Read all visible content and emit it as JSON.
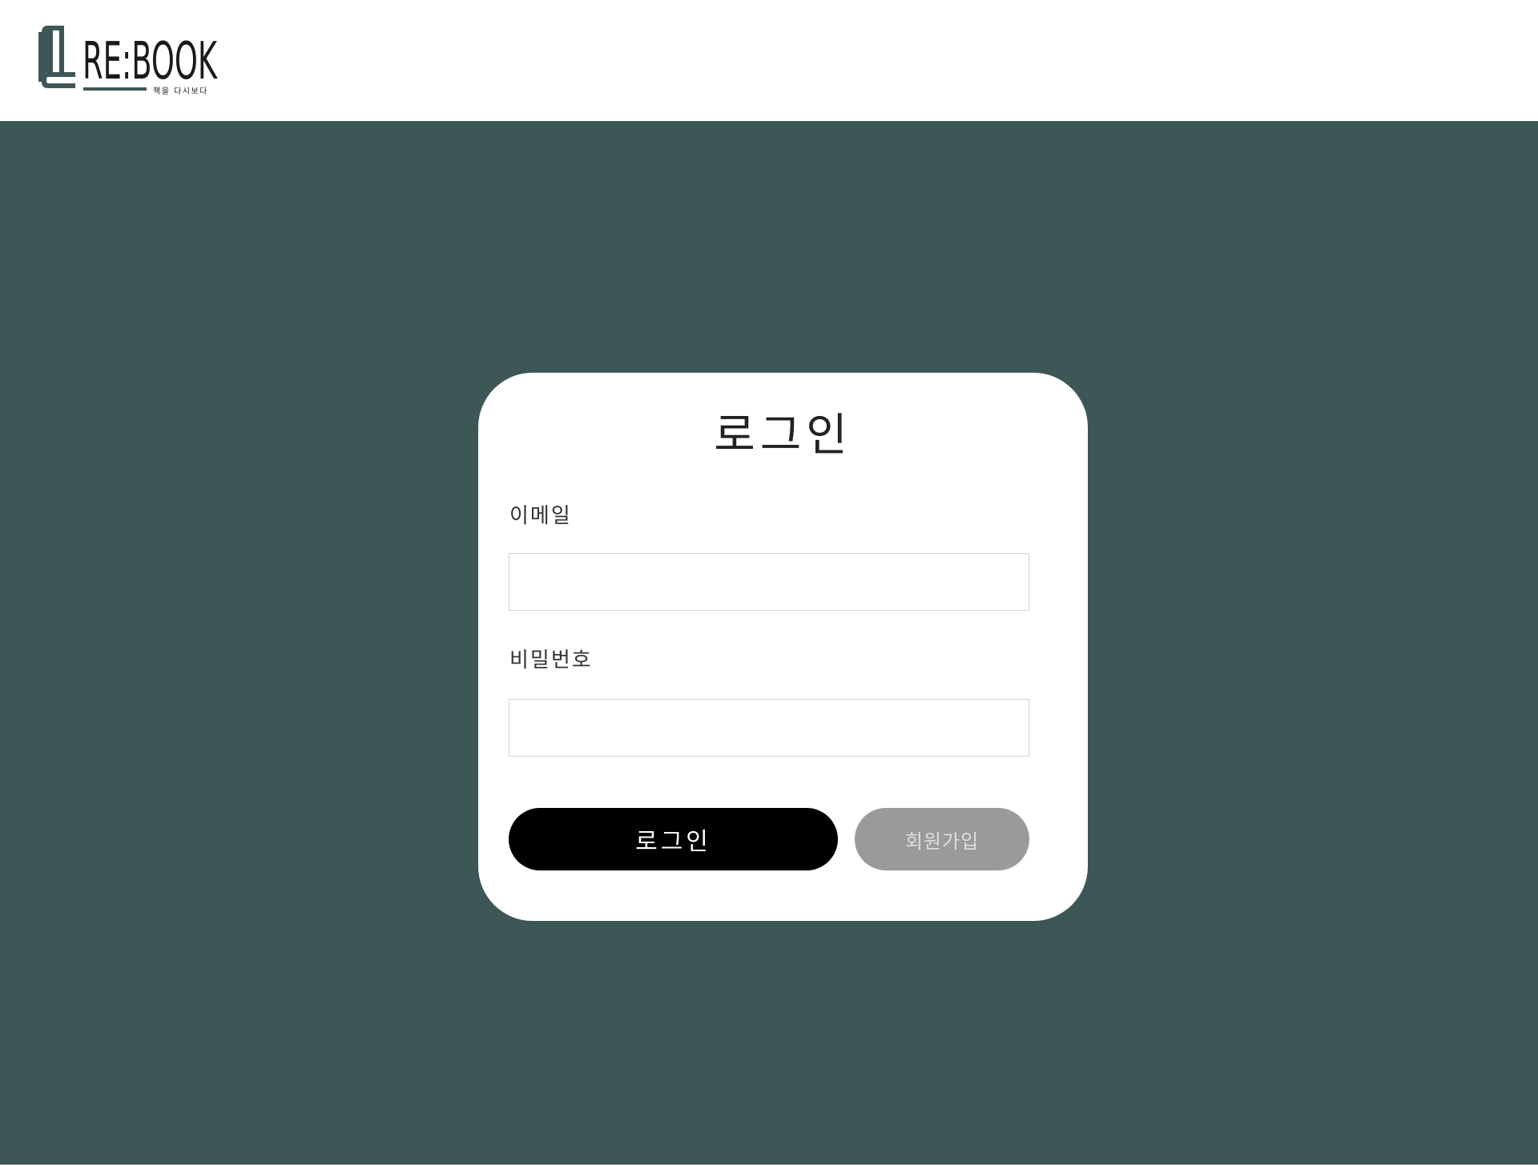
{
  "header": {
    "logo": {
      "text": "RE:BOOK",
      "tagline": "책을 다시보다",
      "icon": "book-icon"
    }
  },
  "login_card": {
    "title": "로그인",
    "email_label": "이메일",
    "email_value": "",
    "password_label": "비밀번호",
    "password_value": "",
    "login_button": "로그인",
    "signup_button": "회원가입"
  },
  "colors": {
    "background": "#3d5756",
    "card": "#ffffff",
    "login_button": "#000000",
    "signup_button": "#9a9a9a",
    "logo": "#3d5756"
  }
}
